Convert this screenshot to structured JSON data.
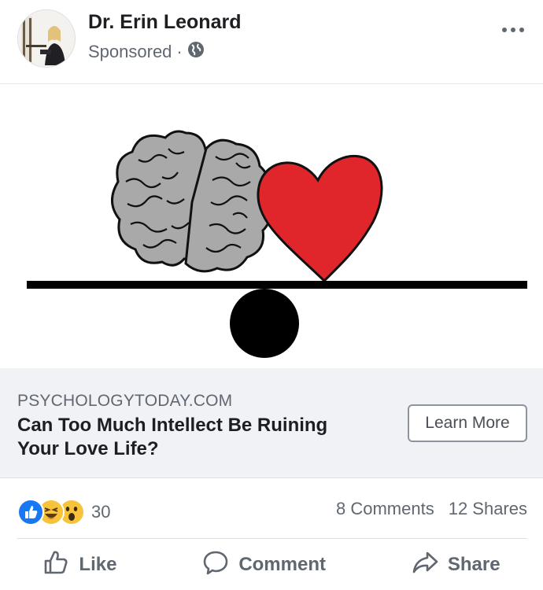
{
  "post": {
    "author": "Dr. Erin Leonard",
    "sponsored_label": "Sponsored",
    "separator": "·",
    "privacy_icon": "globe-icon",
    "menu_icon": "more-options-icon"
  },
  "ad_image": {
    "icons": [
      "brain-icon",
      "heart-icon",
      "seesaw-icon"
    ],
    "colors": {
      "brain": "#a8a8a8",
      "heart": "#e0262b",
      "beam": "#000000"
    }
  },
  "link_preview": {
    "domain": "PSYCHOLOGYTODAY.COM",
    "headline": "Can Too Much Intellect Be Ruining Your Love Life?",
    "cta_label": "Learn More"
  },
  "engagement": {
    "reaction_icons": [
      "like-reaction-icon",
      "haha-reaction-icon",
      "wow-reaction-icon"
    ],
    "reaction_count": "30",
    "comments": "8 Comments",
    "shares": "12 Shares"
  },
  "actions": {
    "like_label": "Like",
    "comment_label": "Comment",
    "share_label": "Share"
  },
  "colors": {
    "text_primary": "#1c1e21",
    "text_secondary": "#606770",
    "link_box_bg": "#f0f2f5",
    "like_blue": "#1877f2",
    "reaction_yellow": "#f7c33b"
  }
}
